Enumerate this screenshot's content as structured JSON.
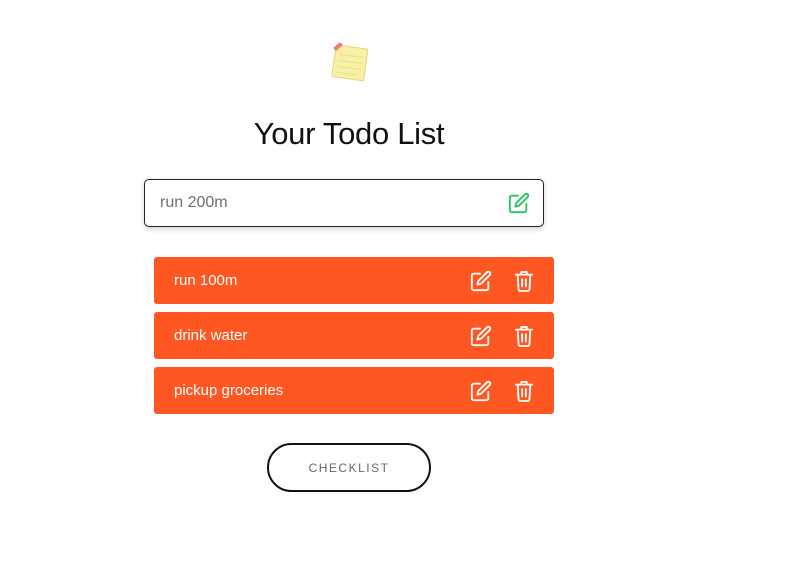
{
  "header": {
    "logo_icon": "sticky-note-icon",
    "title": "Your Todo List"
  },
  "input": {
    "value": "run 200m",
    "add_icon": "edit-icon",
    "add_icon_color": "#22c55e"
  },
  "todos": [
    {
      "text": "run 100m",
      "edit_icon": "edit-icon",
      "delete_icon": "trash-icon"
    },
    {
      "text": "drink water",
      "edit_icon": "edit-icon",
      "delete_icon": "trash-icon"
    },
    {
      "text": "pickup groceries",
      "edit_icon": "edit-icon",
      "delete_icon": "trash-icon"
    }
  ],
  "colors": {
    "item_background": "#ff5722",
    "item_text": "#ffffff"
  },
  "checklist_button": {
    "label": "CHECKLIST"
  }
}
